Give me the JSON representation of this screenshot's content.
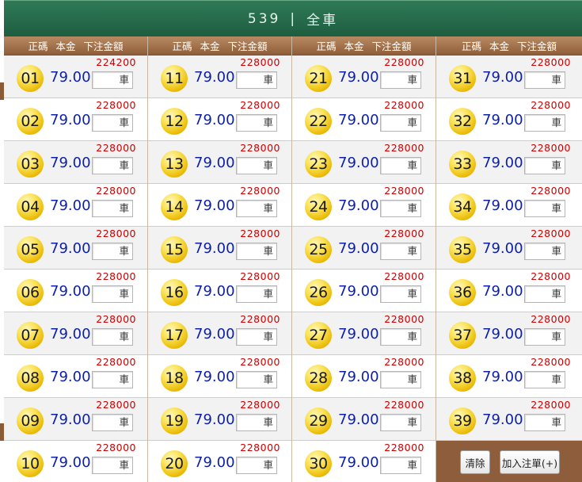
{
  "header": {
    "game": "539",
    "separator": "|",
    "mode": "全車"
  },
  "column_header": {
    "number": "正碼",
    "principal": "本金",
    "bet_amount": "下注金額"
  },
  "bet_suffix": "車",
  "rate": "79.00",
  "cells": [
    {
      "num": "01",
      "limit": "224200"
    },
    {
      "num": "02",
      "limit": "228000"
    },
    {
      "num": "03",
      "limit": "228000"
    },
    {
      "num": "04",
      "limit": "228000"
    },
    {
      "num": "05",
      "limit": "228000"
    },
    {
      "num": "06",
      "limit": "228000"
    },
    {
      "num": "07",
      "limit": "228000"
    },
    {
      "num": "08",
      "limit": "228000"
    },
    {
      "num": "09",
      "limit": "228000"
    },
    {
      "num": "10",
      "limit": "228000"
    },
    {
      "num": "11",
      "limit": "228000"
    },
    {
      "num": "12",
      "limit": "228000"
    },
    {
      "num": "13",
      "limit": "228000"
    },
    {
      "num": "14",
      "limit": "228000"
    },
    {
      "num": "15",
      "limit": "228000"
    },
    {
      "num": "16",
      "limit": "228000"
    },
    {
      "num": "17",
      "limit": "228000"
    },
    {
      "num": "18",
      "limit": "228000"
    },
    {
      "num": "19",
      "limit": "228000"
    },
    {
      "num": "20",
      "limit": "228000"
    },
    {
      "num": "21",
      "limit": "228000"
    },
    {
      "num": "22",
      "limit": "228000"
    },
    {
      "num": "23",
      "limit": "228000"
    },
    {
      "num": "24",
      "limit": "228000"
    },
    {
      "num": "25",
      "limit": "228000"
    },
    {
      "num": "26",
      "limit": "228000"
    },
    {
      "num": "27",
      "limit": "228000"
    },
    {
      "num": "28",
      "limit": "228000"
    },
    {
      "num": "29",
      "limit": "228000"
    },
    {
      "num": "30",
      "limit": "228000"
    },
    {
      "num": "31",
      "limit": "228000"
    },
    {
      "num": "32",
      "limit": "228000"
    },
    {
      "num": "33",
      "limit": "228000"
    },
    {
      "num": "34",
      "limit": "228000"
    },
    {
      "num": "35",
      "limit": "228000"
    },
    {
      "num": "36",
      "limit": "228000"
    },
    {
      "num": "37",
      "limit": "228000"
    },
    {
      "num": "38",
      "limit": "228000"
    },
    {
      "num": "39",
      "limit": "228000"
    }
  ],
  "actions": {
    "clear": "清除",
    "add": "加入注單(+)"
  }
}
